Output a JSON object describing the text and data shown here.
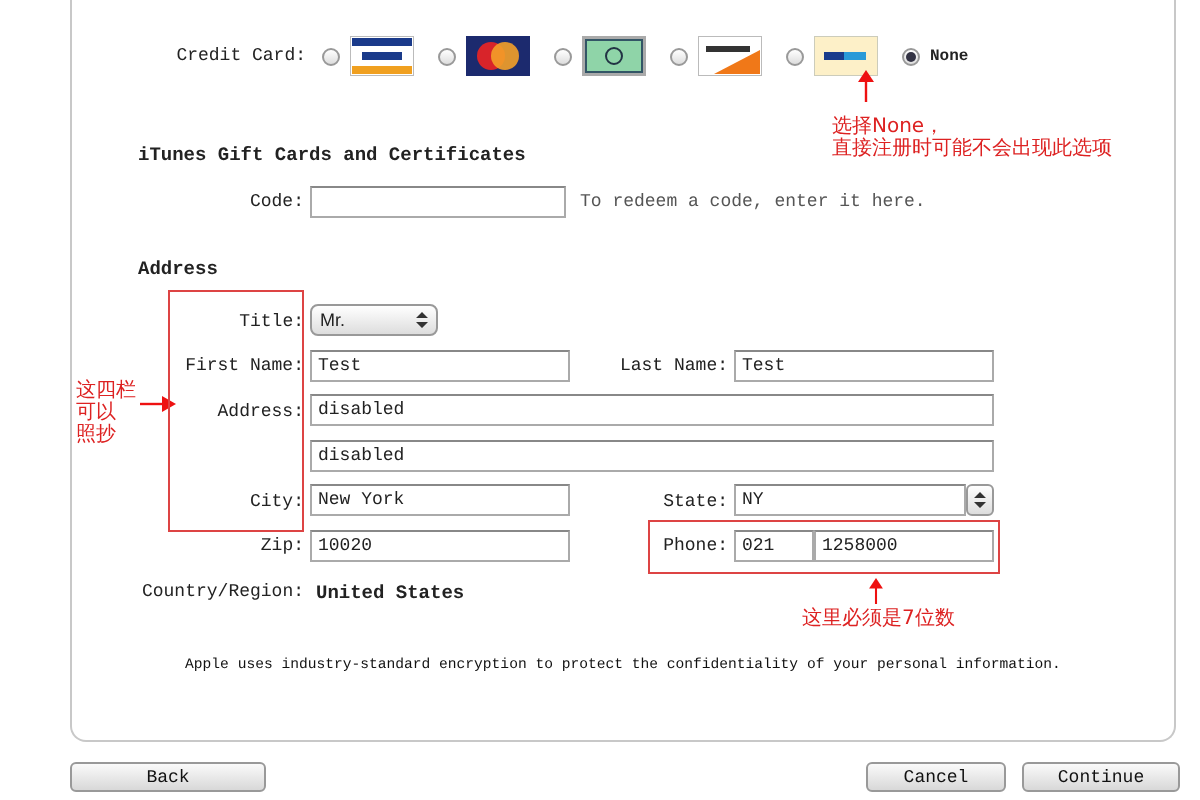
{
  "credit_card": {
    "label": "Credit Card:",
    "options": [
      {
        "kind": "visa",
        "selected": false
      },
      {
        "kind": "mastercard",
        "selected": false
      },
      {
        "kind": "amex",
        "selected": false
      },
      {
        "kind": "discover",
        "selected": false
      },
      {
        "kind": "paypal",
        "selected": false
      },
      {
        "kind": "none",
        "label": "None",
        "selected": true
      }
    ]
  },
  "gift_cards": {
    "heading": "iTunes Gift Cards and Certificates",
    "label": "Code:",
    "hint": "To redeem a code, enter it here."
  },
  "address": {
    "heading": "Address",
    "title": {
      "label": "Title:",
      "value": "Mr."
    },
    "first_name": {
      "label": "First Name:",
      "value": "Test"
    },
    "last_name": {
      "label": "Last Name:",
      "value": "Test"
    },
    "street": {
      "label": "Address:",
      "lines": [
        "disabled",
        "disabled"
      ]
    },
    "city": {
      "label": "City:",
      "value": "New York"
    },
    "state": {
      "label": "State:",
      "value": "NY"
    },
    "zip": {
      "label": "Zip:",
      "value": "10020"
    },
    "phone": {
      "label": "Phone:",
      "area_code": "021",
      "number": "1258000"
    },
    "country": {
      "label": "Country/Region:",
      "value": "United States"
    }
  },
  "notice": "Apple uses industry-standard encryption to protect the confidentiality of your personal information.",
  "buttons": [
    {
      "label": "Back"
    },
    {
      "label": "Cancel"
    },
    {
      "label": "Continue"
    }
  ],
  "annotations": [
    {
      "kind": "none-note",
      "lines": [
        "选择None，",
        "直接注册时可能不会出现此选项"
      ]
    },
    {
      "kind": "copy-note",
      "lines": [
        "这四栏",
        "可以",
        "照抄"
      ]
    },
    {
      "kind": "phone-note",
      "lines": [
        "这里必须是7位数"
      ]
    }
  ]
}
